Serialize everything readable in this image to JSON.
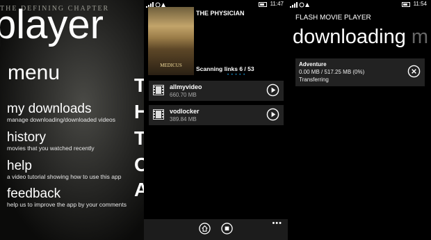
{
  "panel1": {
    "poster_caption": "THE DEFINING CHAPTER",
    "app_title": "player",
    "menu_title": "menu",
    "menu": [
      {
        "label": "my downloads",
        "sub": "manage downloading/downloaded videos"
      },
      {
        "label": "history",
        "sub": "movies that you watched recently"
      },
      {
        "label": "help",
        "sub": "a video tutorial showing how to use this app"
      },
      {
        "label": "feedback",
        "sub": "help us to improve the app by your comments"
      }
    ],
    "edge_letters": [
      "T",
      "H",
      "T",
      "O",
      "A"
    ]
  },
  "panel2": {
    "status_time": "11:47",
    "poster_title": "MEDICUS",
    "movie_title": "THE PHYSICIAN",
    "scanning": "Scanning links 6 / 53",
    "dots": "• • • • •",
    "links": [
      {
        "name": "allmyvideo",
        "size": "660.70 MB"
      },
      {
        "name": "vodlocker",
        "size": "389.84 MB"
      }
    ],
    "more": "•••",
    "edge_letters": [
      "T",
      "H",
      "T",
      "C",
      "A"
    ]
  },
  "panel3": {
    "status_time": "11:54",
    "app_name": "FLASH MOVIE PLAYER",
    "title": "downloading",
    "next_title": "m",
    "download": {
      "title": "Adventure",
      "progress": "0.00 MB / 517.25 MB (0%)",
      "status": "Transferring"
    }
  },
  "icons": [
    "signal-icon",
    "battery-icon",
    "film-icon",
    "play-icon",
    "home-icon",
    "stop-icon",
    "close-icon",
    "more-icon"
  ],
  "colors": {
    "background": "#000000",
    "tile": "#222222",
    "accent": "#1ba1e2",
    "appbar": "#1c1c1c"
  }
}
